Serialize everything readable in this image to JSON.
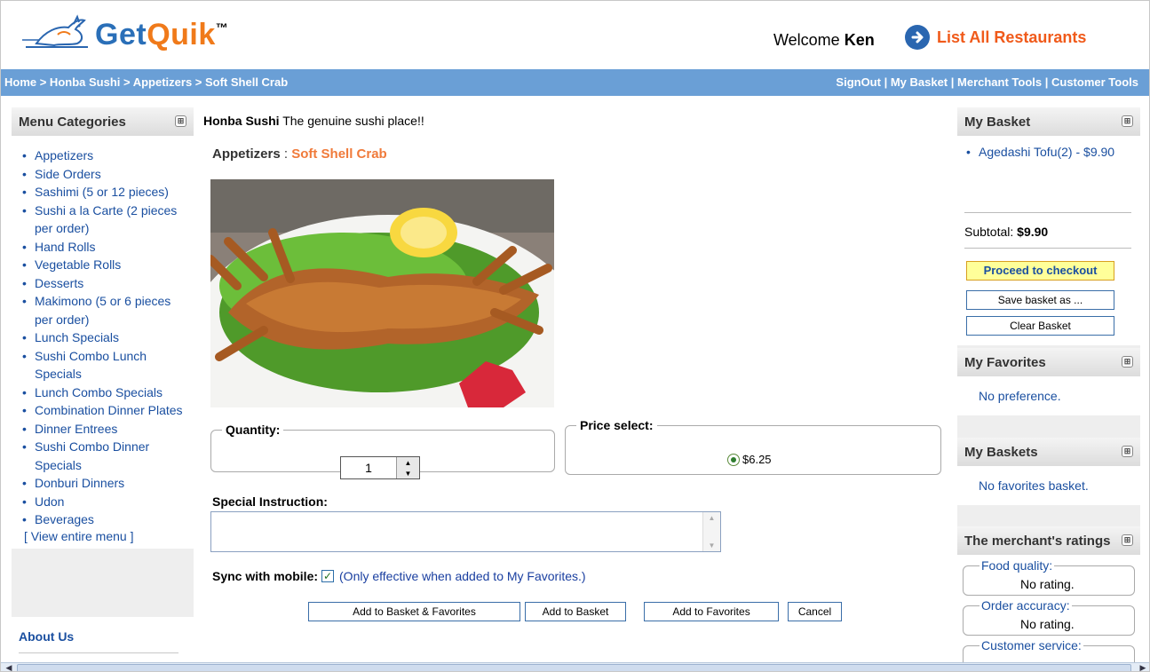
{
  "header": {
    "logo_text_a": "Get",
    "logo_text_b": "Quik",
    "logo_tm": "™",
    "welcome_prefix": "Welcome ",
    "user_name": "Ken",
    "list_all_label": "List All Restaurants"
  },
  "nav": {
    "breadcrumb": "Home > Honba Sushi > Appetizers > Soft Shell Crab",
    "links": [
      "SignOut",
      "My Basket",
      "Merchant Tools",
      "Customer Tools"
    ],
    "separator": " | "
  },
  "left_sidebar": {
    "title": "Menu Categories",
    "categories": [
      "Appetizers",
      "Side Orders",
      "Sashimi (5 or 12 pieces)",
      "Sushi a la Carte (2 pieces per order)",
      "Hand Rolls",
      "Vegetable Rolls",
      "Desserts",
      "Makimono (5 or 6 pieces per order)",
      "Lunch Specials",
      "Sushi Combo Lunch Specials",
      "Lunch Combo Specials",
      "Combination Dinner Plates",
      "Dinner Entrees",
      "Sushi Combo Dinner Specials",
      "Donburi Dinners",
      "Udon",
      "Beverages"
    ],
    "view_entire_menu": "[ View entire menu ]",
    "about_us": "About Us"
  },
  "main": {
    "restaurant_name": "Honba Sushi",
    "tagline": " The genuine sushi place!!",
    "category": "Appetizers",
    "category_sep": " : ",
    "item_name": "Soft Shell Crab",
    "quantity_label": "Quantity:",
    "quantity_value": "1",
    "price_label": "Price select:",
    "price_option": "$6.25",
    "special_label": "Special Instruction:",
    "special_value": "",
    "sync_label": "Sync with mobile:",
    "sync_checked": true,
    "sync_note": "(Only effective when added to My Favorites.)",
    "buttons": {
      "add_basket_fav": "Add to Basket & Favorites",
      "add_basket": "Add to Basket",
      "add_fav": "Add to Favorites",
      "cancel": "Cancel"
    }
  },
  "right_sidebar": {
    "basket": {
      "title": "My Basket",
      "item": "Agedashi Tofu(2) - $9.90",
      "subtotal_label": "Subtotal: ",
      "subtotal_value": "$9.90",
      "checkout": "Proceed to checkout",
      "save": "Save basket as ...",
      "clear": "Clear Basket"
    },
    "favorites": {
      "title": "My Favorites",
      "text": "No preference."
    },
    "baskets": {
      "title": "My Baskets",
      "text": "No favorites basket."
    },
    "ratings": {
      "title": "The merchant's ratings",
      "items": [
        {
          "label": "Food quality:",
          "value": "No rating."
        },
        {
          "label": "Order accuracy:",
          "value": "No rating."
        },
        {
          "label": "Customer service:",
          "value": ""
        }
      ]
    }
  },
  "colors": {
    "accent_blue": "#6a9fd6",
    "link_blue": "#1a4fa0",
    "orange": "#f07a3a",
    "checkout_bg": "#ffff99"
  }
}
